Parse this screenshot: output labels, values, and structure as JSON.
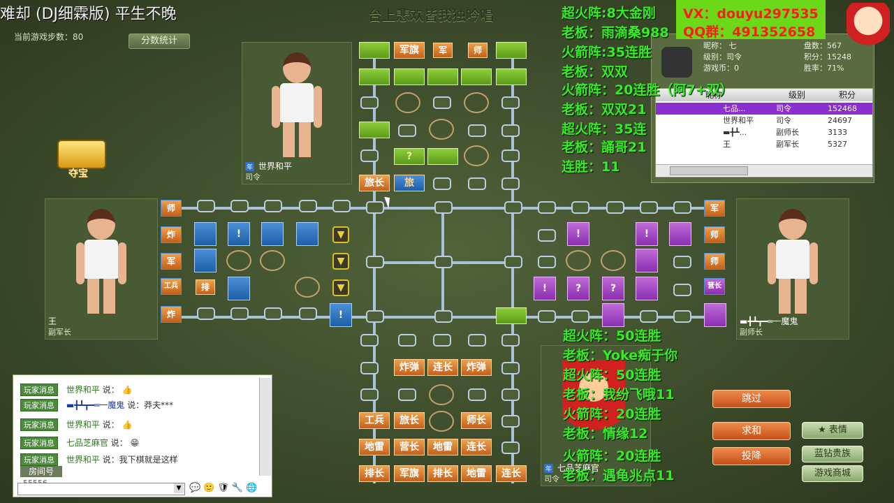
{
  "window": {
    "title": "难却 (DJ细霖版) 平生不晚",
    "subtitle": "台上悲欢皆我独吟唱"
  },
  "game": {
    "steps_label": "当前游戏步数：80",
    "score_button": "分数统计",
    "treasure_label": "夺宝"
  },
  "players": {
    "top": {
      "name": "世界和平",
      "rank": "司令"
    },
    "left": {
      "name": "王",
      "rank": "副军长"
    },
    "right": {
      "name": "▬╋┻┳━═一魔鬼",
      "rank": "副师长"
    },
    "bottom": {
      "name": "七品芝麻官",
      "rank": "司令"
    }
  },
  "board": {
    "top_pieces": [
      "军旗",
      "军",
      "师",
      "?",
      "旅长",
      "旅"
    ],
    "left_pieces": [
      "师",
      "炸",
      "军",
      "工兵",
      "炸",
      "排",
      "!",
      "!"
    ],
    "right_pieces": [
      "军",
      "师",
      "师",
      "营长",
      "!",
      "!",
      "!",
      "?",
      "?"
    ],
    "bottom_pieces": [
      "炸弹",
      "连长",
      "炸弹",
      "工兵",
      "旅长",
      "师长",
      "地雷",
      "营长",
      "地雷",
      "连长",
      "排长",
      "军旗",
      "排长",
      "地雷",
      "连长"
    ],
    "center_piece": "!"
  },
  "profile": {
    "nickname_label": "昵称：",
    "nickname": "七",
    "level_label": "级别：司令",
    "coins_label": "游戏币：0",
    "games_label": "盘数：567",
    "score_label": "积分：15248",
    "winrate_label": "胜率：71%"
  },
  "table": {
    "headers": [
      "昵称",
      "级别",
      "积分"
    ],
    "rows": [
      {
        "name": "七品...",
        "rank": "司令",
        "score": "152468"
      },
      {
        "name": "世界和平",
        "rank": "司令",
        "score": "24697"
      },
      {
        "name": "▬╋┻...",
        "rank": "副师长",
        "score": "3133"
      },
      {
        "name": "王",
        "rank": "副军长",
        "score": "5327"
      }
    ]
  },
  "chat": {
    "tag": "玩家消息",
    "lines": [
      {
        "name": "世界和平",
        "say": "说："
      },
      {
        "name": "▬╋┻┳━═一魔鬼",
        "say": "说：莽夫***"
      },
      {
        "name": "世界和平",
        "say": "说："
      },
      {
        "name": "七品芝麻官",
        "say": "说："
      },
      {
        "name": "世界和平",
        "say": "说：我下棋就是这样"
      }
    ],
    "room_label": "房间号",
    "room_number": "55556"
  },
  "actions": {
    "skip": "跳过",
    "peace": "求和",
    "surrender": "投降",
    "emotion": "表情",
    "diamond": "蓝钻贵族",
    "shop": "游戏商城"
  },
  "overlay": {
    "vx": "VX：douyu297535",
    "qq": "QQ群：491352658",
    "right_lines": [
      "超火阵:8大金刚",
      "老板：雨滴桑988",
      "火箭阵:35连胜",
      "老板：双双",
      "火箭阵：20连胜（阿7+双）",
      "老板：双双21",
      "超火阵：35连",
      "老板：誦哥21",
      "连胜：11"
    ],
    "bottom_lines": [
      "超火阵：50连胜",
      "老板：Yoke痴于你",
      "超火阵：50连胜",
      "老板：我纷飞哦11",
      "火箭阵：20连胜",
      "老板：情缘12",
      "火箭阵：20连胜",
      "老板：遇龟兆点11"
    ]
  }
}
